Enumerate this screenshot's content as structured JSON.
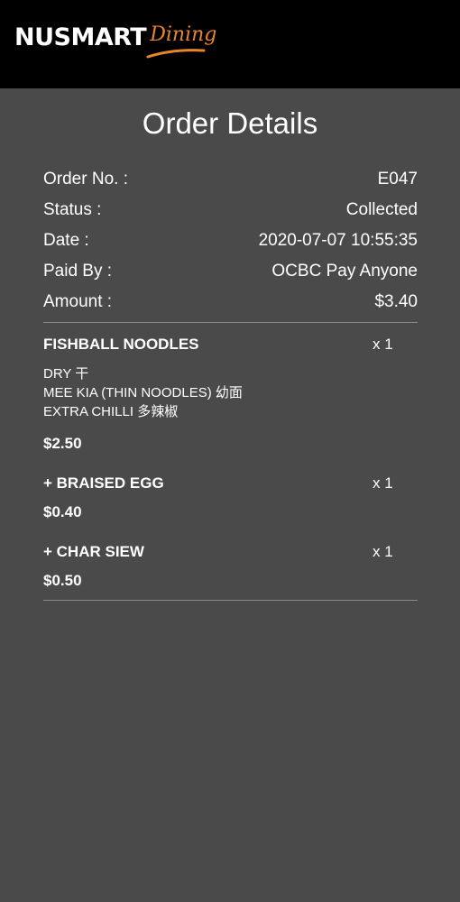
{
  "app": {
    "logo_main": "NUSMART",
    "logo_script": "Dining",
    "accent_color": "#e8852a"
  },
  "page": {
    "title": "Order Details"
  },
  "order_info": [
    {
      "label": "Order No. :",
      "value": "E047"
    },
    {
      "label": "Status :",
      "value": "Collected"
    },
    {
      "label": "Date :",
      "value": "2020-07-07 10:55:35"
    },
    {
      "label": "Paid By :",
      "value": "OCBC Pay Anyone"
    },
    {
      "label": "Amount :",
      "value": "$3.40"
    }
  ],
  "items": [
    {
      "name": "FISHBALL NOODLES",
      "qty": "x 1",
      "options": [
        "DRY 干",
        "MEE KIA (THIN NOODLES) 幼面",
        "EXTRA CHILLI 多辣椒"
      ],
      "price": "$2.50"
    },
    {
      "name": "+ BRAISED EGG",
      "qty": "x 1",
      "price": "$0.40"
    },
    {
      "name": "+ CHAR SIEW",
      "qty": "x 1",
      "price": "$0.50"
    }
  ]
}
